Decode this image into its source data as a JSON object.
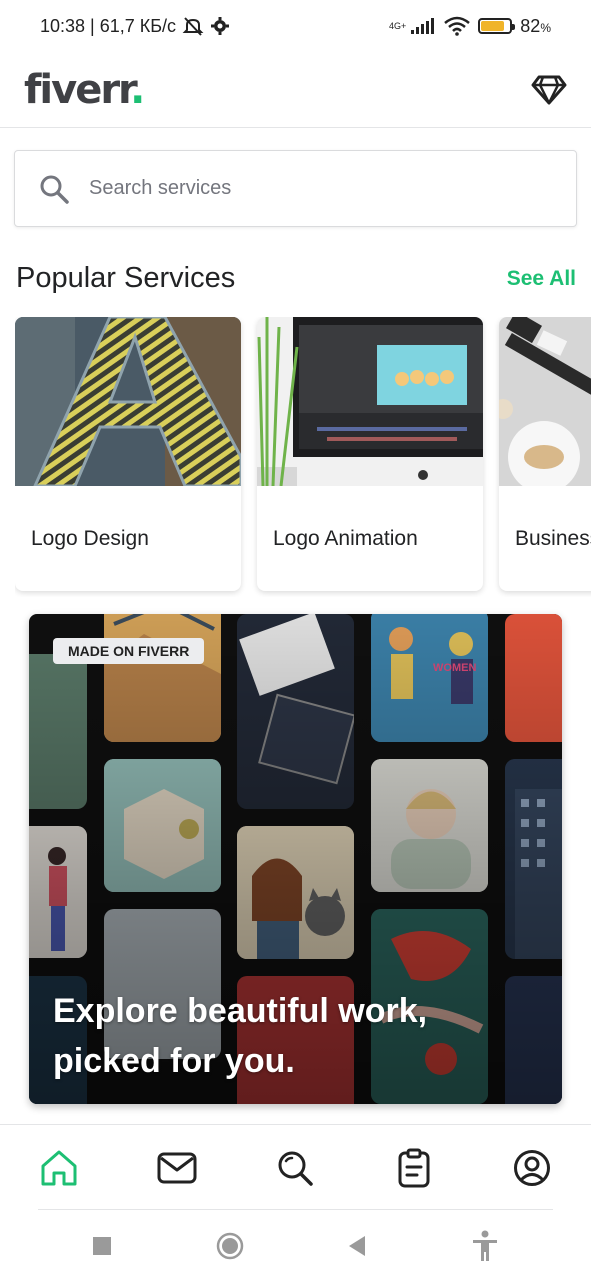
{
  "status_bar": {
    "time_speed": "10:38 | 61,7 КБ/с",
    "network": "4G+",
    "battery": "82",
    "battery_unit": "%",
    "battery_level": 0.82
  },
  "header": {
    "logo_text": "fiverr",
    "logo_dot": ".",
    "diamond_icon": "diamond-icon"
  },
  "search": {
    "placeholder": "Search services"
  },
  "popular": {
    "title": "Popular Services",
    "see_all": "See All",
    "cards": [
      {
        "label": "Logo Design"
      },
      {
        "label": "Logo Animation"
      },
      {
        "label": "Business Stationery"
      }
    ]
  },
  "banner": {
    "badge": "MADE ON FIVERR",
    "headline_line1": "Explore beautiful work,",
    "headline_line2": "picked for you."
  },
  "bottom_nav": {
    "items": [
      {
        "name": "home",
        "icon": "home-icon",
        "active": true
      },
      {
        "name": "messages",
        "icon": "envelope-icon",
        "active": false
      },
      {
        "name": "search",
        "icon": "search-icon",
        "active": false
      },
      {
        "name": "orders",
        "icon": "clipboard-icon",
        "active": false
      },
      {
        "name": "profile",
        "icon": "user-circle-icon",
        "active": false
      }
    ]
  },
  "colors": {
    "brand_green": "#1dbf73",
    "text_dark": "#222325",
    "text_muted": "#74767e"
  }
}
